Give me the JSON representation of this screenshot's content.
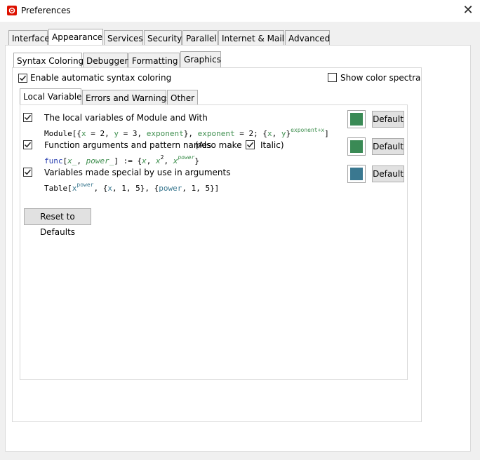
{
  "window": {
    "title": "Preferences",
    "close_glyph": "✕",
    "app_icon": "gear-icon"
  },
  "main_tabs": [
    "Interface",
    "Appearance",
    "Services",
    "Security",
    "Parallel",
    "Internet & Mail",
    "Advanced"
  ],
  "sub_tabs": [
    "Syntax Coloring",
    "Debugger",
    "Formatting",
    "Graphics"
  ],
  "syntax": {
    "enable_label": "Enable automatic syntax coloring",
    "enable_checked": true,
    "show_spectra_label": "Show color spectra",
    "show_spectra_checked": false
  },
  "inner_tabs": [
    "Local Variables",
    "Errors and Warnings",
    "Other"
  ],
  "items": [
    {
      "label": "The local variables of Module and With",
      "checked": true,
      "color": "#3a8a55",
      "default_label": "Default",
      "code_parts": [
        "Module",
        "[{",
        "x",
        " = 2, ",
        "y",
        " = 3, ",
        "exponent",
        "}, ",
        "exponent",
        " = 2; {",
        "x",
        ", ",
        "y",
        "}",
        "exponent+x",
        "]"
      ]
    },
    {
      "label": "Function arguments and pattern names",
      "label2": "(Also make",
      "italic_label": "Italic)",
      "italic_checked": true,
      "checked": true,
      "color": "#3a8a55",
      "default_label": "Default",
      "code_parts": [
        "func",
        "[",
        "x_",
        ", ",
        "power_",
        "] := {",
        "x",
        ", ",
        "x",
        "2",
        ", ",
        "x",
        "power",
        "}"
      ]
    },
    {
      "label": "Variables made special by use in arguments",
      "checked": true,
      "color": "#3a7890",
      "default_label": "Default",
      "code_parts": [
        "Table",
        "[",
        "x",
        "power",
        ", {",
        "x",
        ", 1, 5}, {",
        "power",
        ", 1, 5}]"
      ]
    }
  ],
  "reset_label": "Reset to Defaults",
  "colors": {
    "green": "#3a8a55",
    "teal": "#3a7890",
    "code_green": "#3f8f4f",
    "code_blue": "#2a3fb0"
  }
}
